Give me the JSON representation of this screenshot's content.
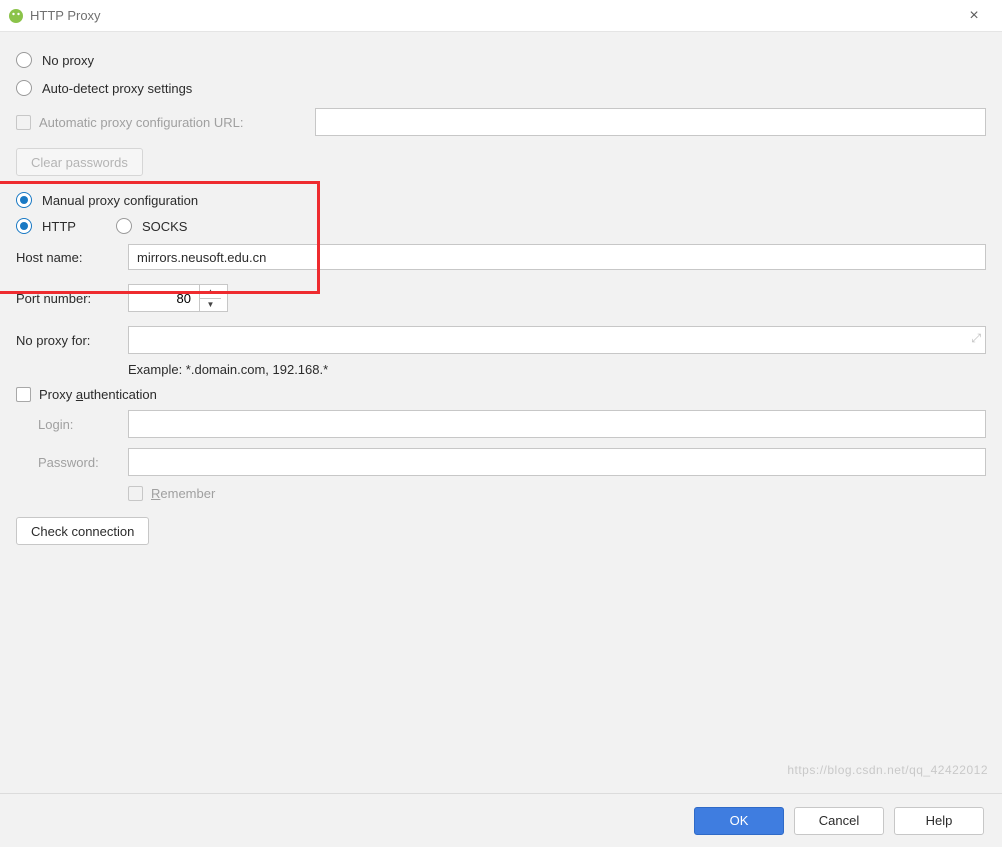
{
  "window": {
    "title": "HTTP Proxy"
  },
  "options": {
    "no_proxy": "No proxy",
    "auto_detect": "Auto-detect proxy settings",
    "auto_url_label": "Automatic proxy configuration URL:",
    "clear_passwords": "Clear passwords",
    "manual": "Manual proxy configuration",
    "protocol_http": "HTTP",
    "protocol_socks": "SOCKS",
    "host_label": "Host name:",
    "host_value": "mirrors.neusoft.edu.cn",
    "port_label": "Port number:",
    "port_value": "80",
    "no_proxy_for_label": "No proxy for:",
    "example": "Example: *.domain.com, 192.168.*",
    "proxy_auth": "Proxy authentication",
    "proxy_auth_underline": "a",
    "login_label": "Login:",
    "password_label": "Password:",
    "remember": "Remember",
    "remember_underline": "R",
    "check_connection": "Check connection"
  },
  "footer": {
    "ok": "OK",
    "cancel": "Cancel",
    "help": "Help"
  },
  "watermark": "https://blog.csdn.net/qq_42422012"
}
